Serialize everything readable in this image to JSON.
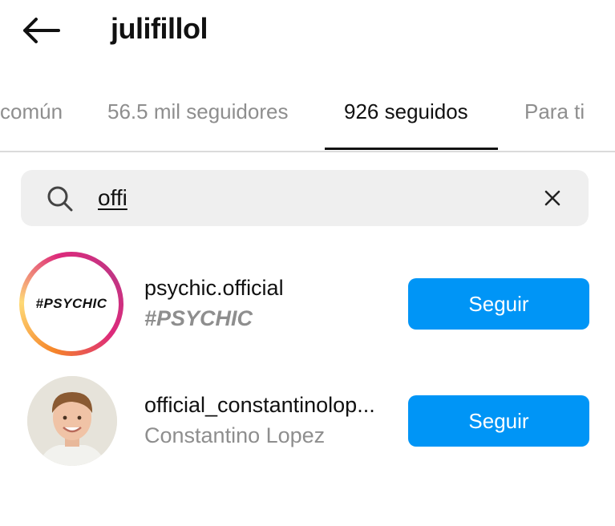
{
  "theme": {
    "accent": "#0095f6",
    "text": "#111111",
    "muted": "#8e8e8e",
    "search_bg": "#efefef"
  },
  "header": {
    "back_icon": "arrow-left-icon",
    "title": "julifillol"
  },
  "tabs": [
    {
      "label": "común",
      "active": false
    },
    {
      "label": "56.5 mil seguidores",
      "active": false
    },
    {
      "label": "926 seguidos",
      "active": true
    },
    {
      "label": "Para ti",
      "active": false
    }
  ],
  "search": {
    "icon": "search-icon",
    "value": "offi",
    "clear_icon": "close-icon"
  },
  "results": [
    {
      "username": "psychic.official",
      "fullname": "#PSYCHIC",
      "avatar_text": "#PSYCHIC",
      "has_story_ring": true,
      "button_label": "Seguir"
    },
    {
      "username": "official_constantinolop...",
      "fullname": "Constantino Lopez",
      "has_story_ring": false,
      "button_label": "Seguir"
    }
  ]
}
